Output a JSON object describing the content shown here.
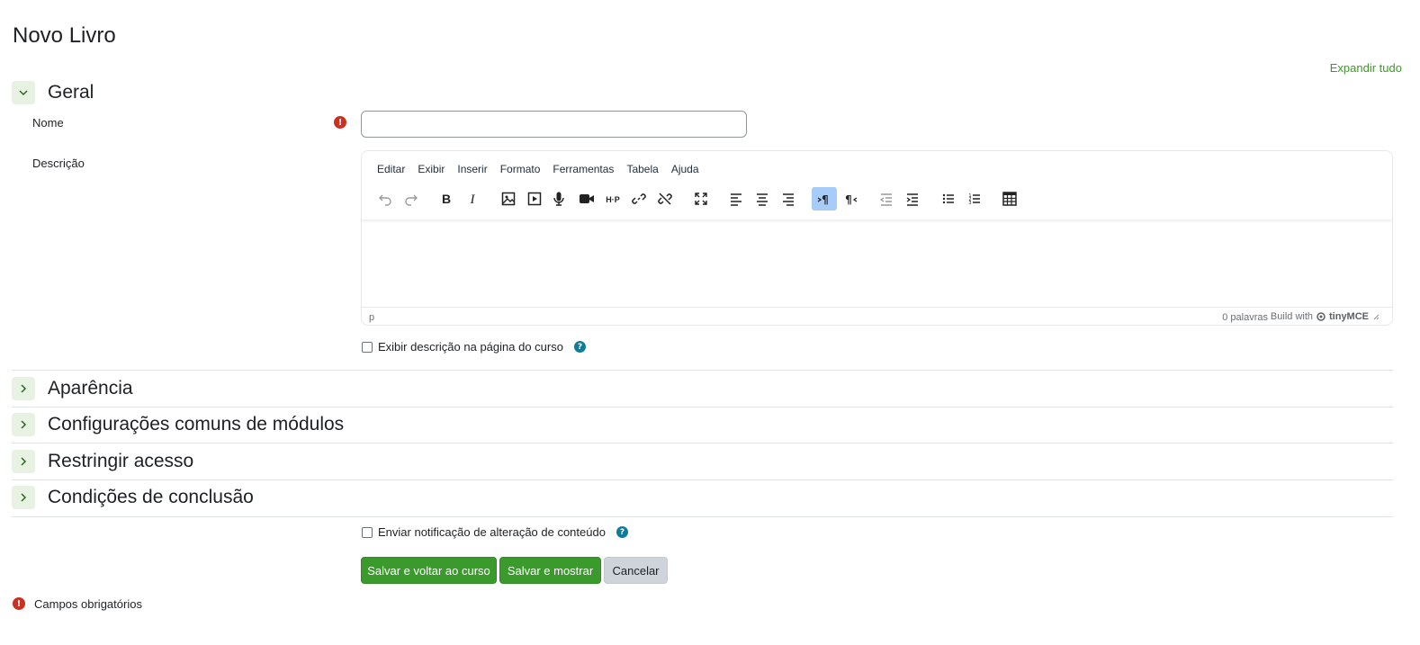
{
  "page": {
    "title": "Novo Livro",
    "expand_all": "Expandir tudo"
  },
  "sections": {
    "general": "Geral",
    "appearance": "Aparência",
    "common_modules": "Configurações comuns de módulos",
    "restrict_access": "Restringir acesso",
    "completion": "Condições de conclusão"
  },
  "form": {
    "name_label": "Nome",
    "name_value": "",
    "description_label": "Descrição",
    "show_description_label": "Exibir descrição na página do curso",
    "notify_label": "Enviar notificação de alteração de conteúdo",
    "required_legend": "Campos obrigatórios"
  },
  "editor": {
    "menu": [
      "Editar",
      "Exibir",
      "Inserir",
      "Formato",
      "Ferramentas",
      "Tabela",
      "Ajuda"
    ],
    "toolbar_icons": [
      "undo-icon",
      "redo-icon",
      "bold-icon",
      "italic-icon",
      "image-icon",
      "media-icon",
      "microphone-icon",
      "video-camera-icon",
      "h5p-icon",
      "link-icon",
      "unlink-icon",
      "fullscreen-icon",
      "align-left-icon",
      "align-center-icon",
      "align-right-icon",
      "ltr-icon",
      "rtl-icon",
      "outdent-icon",
      "indent-icon",
      "bullet-list-icon",
      "numbered-list-icon",
      "table-icon"
    ],
    "h5p_label": "H·P",
    "path": "p",
    "word_count": "0 palavras",
    "build_with": "Build with",
    "brand": "tinyMCE"
  },
  "buttons": {
    "save_return": "Salvar e voltar ao curso",
    "save_display": "Salvar e mostrar",
    "cancel": "Cancelar"
  },
  "colors": {
    "accent_green": "#3a9a2b",
    "required_red": "#ca3120",
    "help_blue": "#0f7b9a"
  }
}
